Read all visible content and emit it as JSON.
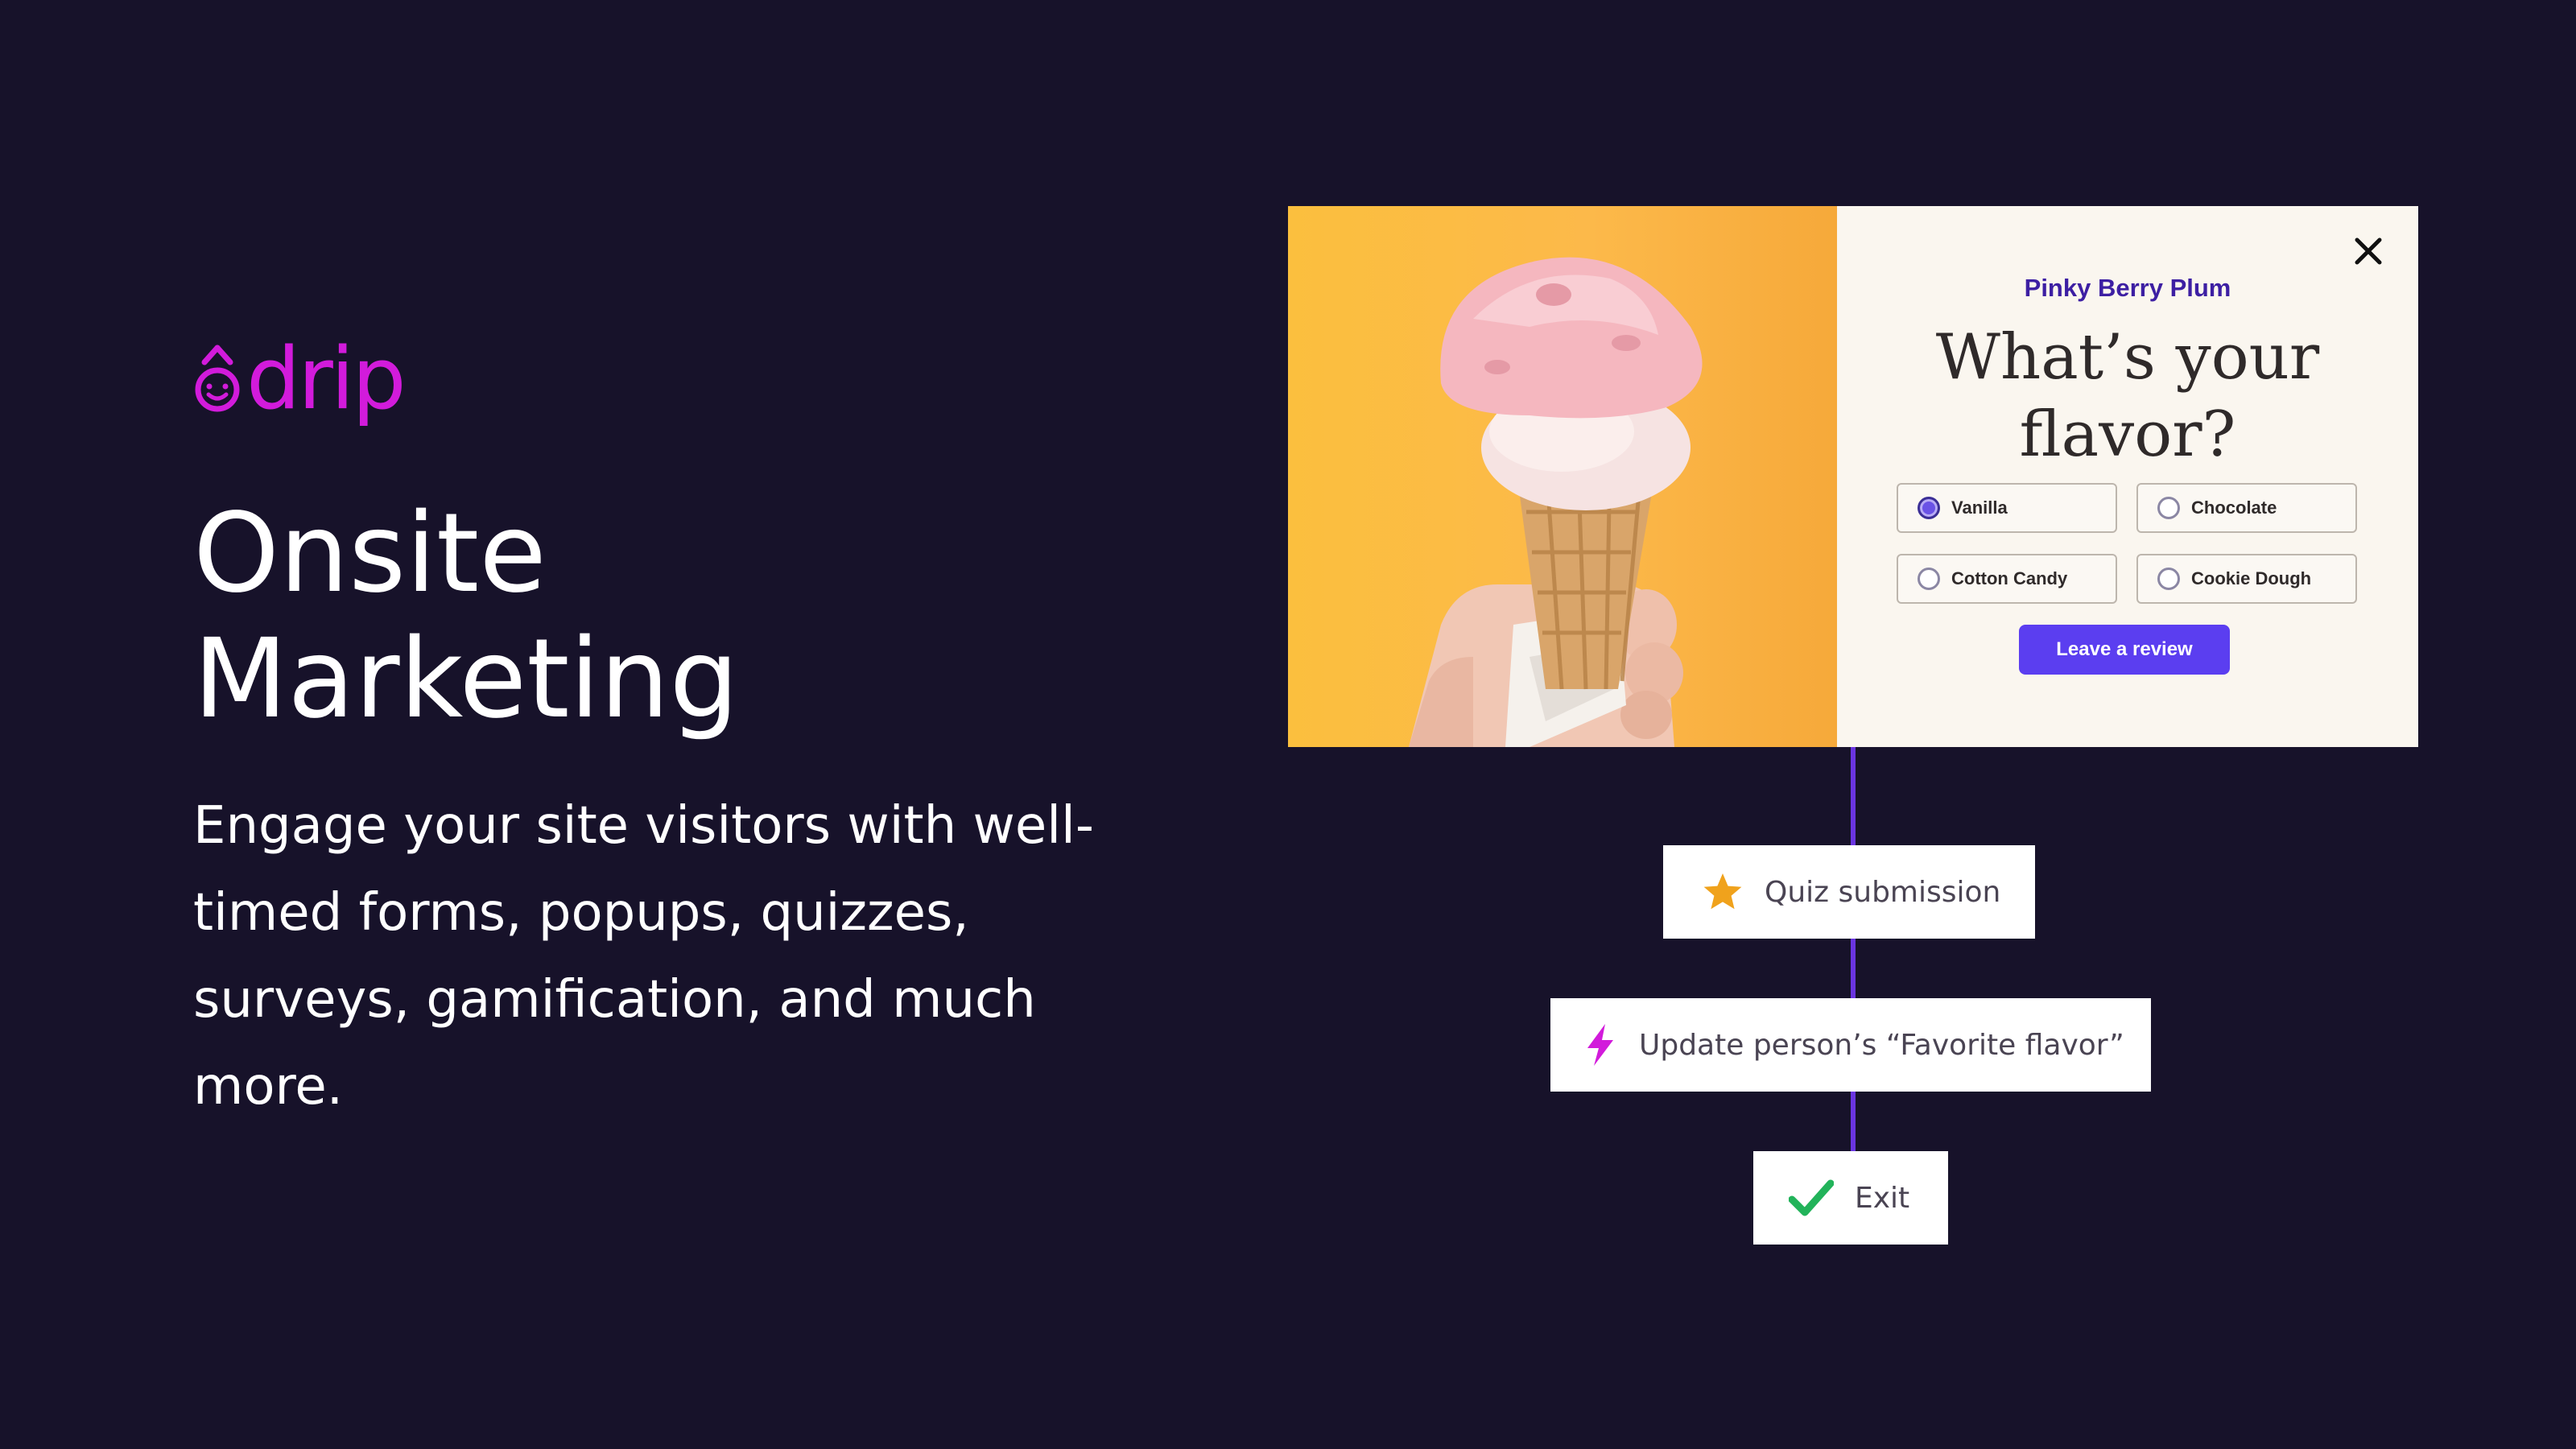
{
  "brand": {
    "logo_text": "drip",
    "accent_color": "#d21bdb"
  },
  "hero": {
    "headline_line1": "Onsite",
    "headline_line2": "Marketing",
    "body": "Engage your site visitors with well-timed forms, popups, quizzes, surveys, gamification, and much more."
  },
  "popup": {
    "image_icon": "ice-cream-cone-photo",
    "close_icon": "close-icon",
    "brand_name": "Pinky Berry Plum",
    "question_line1": "What’s your",
    "question_line2": "flavor?",
    "options": [
      {
        "label": "Vanilla",
        "selected": true
      },
      {
        "label": "Chocolate",
        "selected": false
      },
      {
        "label": "Cotton Candy",
        "selected": false
      },
      {
        "label": "Cookie Dough",
        "selected": false
      }
    ],
    "cta_label": "Leave a review",
    "cta_color": "#5b3ef0"
  },
  "workflow": {
    "connector_color": "#6a35e0",
    "steps": [
      {
        "icon": "star-icon",
        "label": "Quiz submission",
        "icon_color": "#f0a21c"
      },
      {
        "icon": "lightning-icon",
        "label": "Update person’s “Favorite flavor”",
        "icon_color": "#d21bdb"
      },
      {
        "icon": "checkmark-icon",
        "label": "Exit",
        "icon_color": "#22b35a"
      }
    ]
  }
}
